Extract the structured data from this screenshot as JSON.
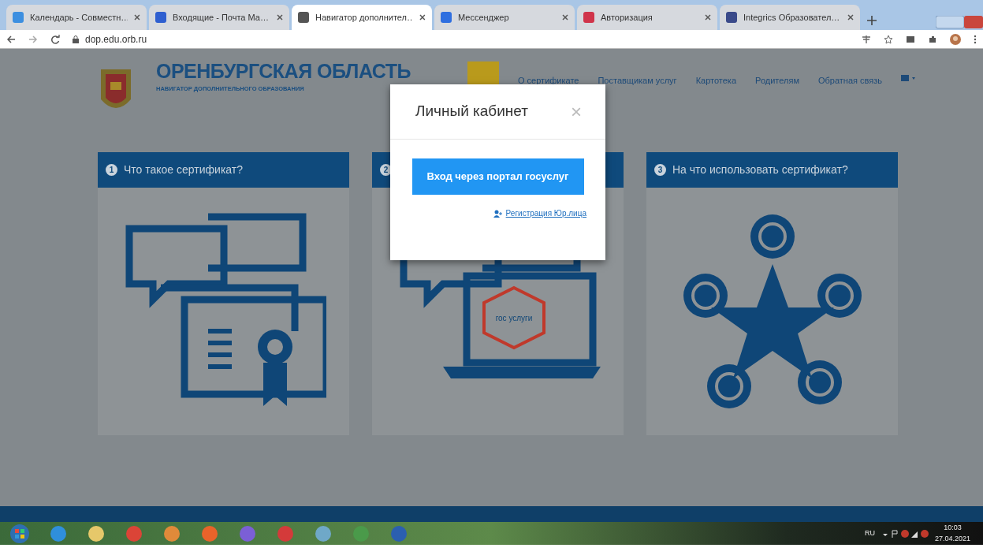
{
  "browser": {
    "tabs": [
      {
        "title": "Календарь - Совместн…",
        "selected": false,
        "color": "#3d8fe0"
      },
      {
        "title": "Входящие - Почта Ма…",
        "selected": false,
        "color": "#2f5fd0"
      },
      {
        "title": "Навигатор дополнител…",
        "selected": true,
        "color": "#555555"
      },
      {
        "title": "Мессенджер",
        "selected": false,
        "color": "#2f6fe0"
      },
      {
        "title": "Авторизация",
        "selected": false,
        "color": "#d0344a"
      },
      {
        "title": "Integrics Образовател…",
        "selected": false,
        "color": "#3a4a8a"
      }
    ],
    "address": "dop.edu.orb.ru"
  },
  "site": {
    "title": "ОРЕНБУРГСКАЯ ОБЛАСТЬ",
    "subtitle": "НАВИГАТОР ДОПОЛНИТЕЛЬНОГО ОБРАЗОВАНИЯ",
    "nav": [
      "О сертификате",
      "Поставщикам услуг",
      "Картотека",
      "Родителям",
      "Обратная связь"
    ],
    "cards": [
      {
        "kind": "certificate",
        "number": "1",
        "title": "Что такое сертификат?"
      },
      {
        "kind": "laptop",
        "number": "2",
        "logo": "гос услуги"
      },
      {
        "kind": "uses",
        "number": "3",
        "title": "На что использовать сертификат?"
      }
    ]
  },
  "modal": {
    "title": "Личный кабинет",
    "close": "×",
    "login_button": "Вход через портал госуслуг",
    "register_link": "Регистрация Юр.лица"
  },
  "taskbar": {
    "language": "RU",
    "time": "10:03",
    "date": "27.04.2021"
  }
}
